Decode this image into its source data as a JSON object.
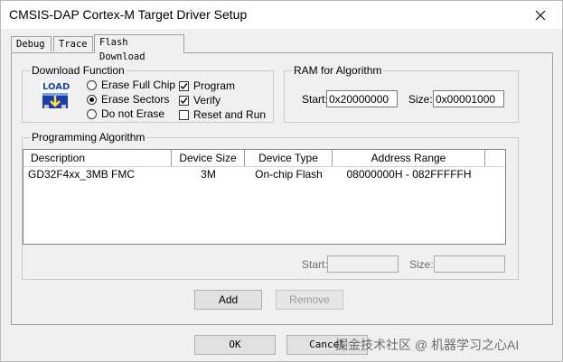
{
  "window": {
    "title": "CMSIS-DAP Cortex-M Target Driver Setup"
  },
  "tabs": [
    {
      "label": "Debug"
    },
    {
      "label": "Trace"
    },
    {
      "label": "Flash Download",
      "active": true
    }
  ],
  "download_function": {
    "group_label": "Download Function",
    "load_icon_text": "LOAD",
    "radios": [
      {
        "label": "Erase Full Chip",
        "checked": false
      },
      {
        "label": "Erase Sectors",
        "checked": true
      },
      {
        "label": "Do not Erase",
        "checked": false
      }
    ],
    "checkboxes": [
      {
        "label": "Program",
        "checked": true
      },
      {
        "label": "Verify",
        "checked": true
      },
      {
        "label": "Reset and Run",
        "checked": false
      }
    ]
  },
  "ram_for_algorithm": {
    "group_label": "RAM for Algorithm",
    "start_label": "Start:",
    "start_value": "0x20000000",
    "size_label": "Size:",
    "size_value": "0x00001000"
  },
  "programming_algorithm": {
    "group_label": "Programming Algorithm",
    "columns": [
      "Description",
      "Device Size",
      "Device Type",
      "Address Range"
    ],
    "rows": [
      {
        "description": "GD32F4xx_3MB FMC",
        "device_size": "3M",
        "device_type": "On-chip Flash",
        "address_range": "08000000H - 082FFFFFH"
      }
    ],
    "start_label": "Start:",
    "start_value": "",
    "size_label": "Size:",
    "size_value": ""
  },
  "buttons": {
    "add": "Add",
    "remove": "Remove",
    "ok": "OK",
    "cancel": "Cancel"
  },
  "watermark": "掘金技术社区 @ 机器学习之心AI",
  "colors": {
    "title_bg": "#ffffff",
    "dialog_bg": "#f0f0f0",
    "accent": "#0078d7"
  }
}
